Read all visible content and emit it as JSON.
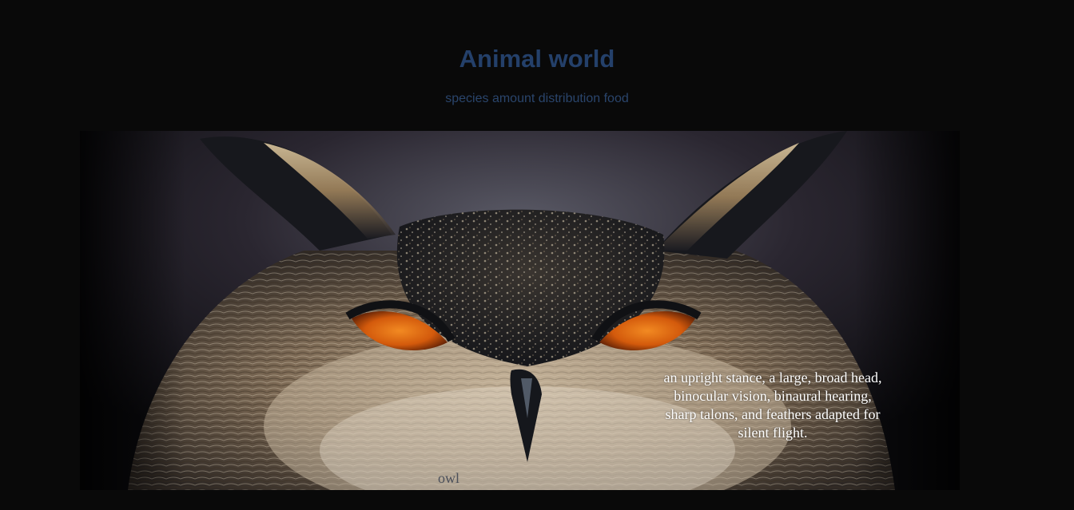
{
  "header": {
    "title": "Animal world",
    "nav": [
      {
        "label": "species"
      },
      {
        "label": "amount"
      },
      {
        "label": "distribution"
      },
      {
        "label": "food"
      }
    ]
  },
  "hero": {
    "image_icon": "owl-photo",
    "description": "an upright stance, a large, broad head, binocular vision, binaural hearing, sharp talons, and feathers adapted for silent flight.",
    "label": "owl"
  },
  "colors": {
    "background": "#090909",
    "title": "#24406a",
    "nav": "#2a456c",
    "caption": "#ffffff",
    "owl_eye": "#e06a10"
  }
}
